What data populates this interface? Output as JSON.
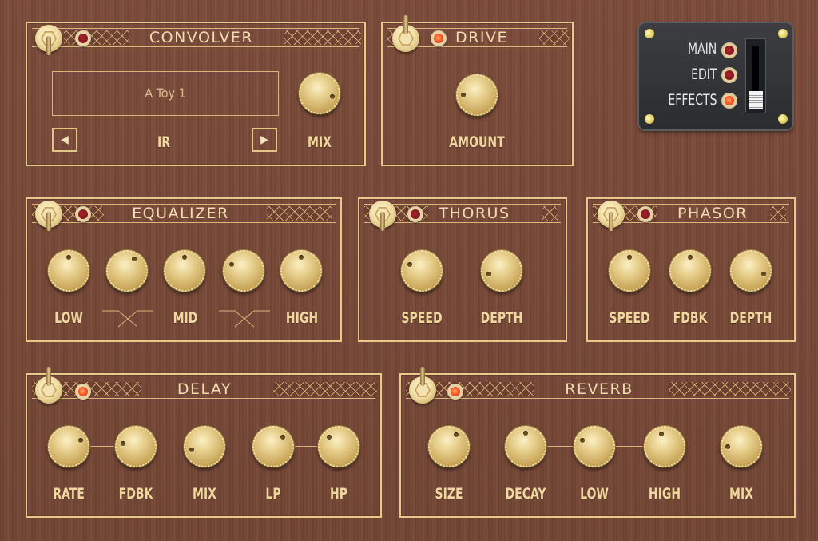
{
  "navigation": {
    "items": [
      {
        "label": "MAIN",
        "active": false
      },
      {
        "label": "EDIT",
        "active": false
      },
      {
        "label": "EFFECTS",
        "active": true
      }
    ],
    "slider_position": "EFFECTS"
  },
  "modules": {
    "convolver": {
      "title": "CONVOLVER",
      "enabled": false,
      "ir_display": "A Toy 1",
      "ir_label": "IR",
      "prev_icon": "◀",
      "next_icon": "▶",
      "knobs": [
        {
          "label": "MIX",
          "value": 0.85
        }
      ]
    },
    "drive": {
      "title": "DRIVE",
      "enabled": true,
      "knobs": [
        {
          "label": "AMOUNT",
          "value": 0.2
        }
      ]
    },
    "equalizer": {
      "title": "EQUALIZER",
      "enabled": false,
      "knobs": [
        {
          "label": "LOW",
          "value": 0.5
        },
        {
          "label": "",
          "value": 0.6
        },
        {
          "label": "MID",
          "value": 0.5
        },
        {
          "label": "",
          "value": 0.3
        },
        {
          "label": "HIGH",
          "value": 0.5
        }
      ]
    },
    "thorus": {
      "title": "THORUS",
      "enabled": false,
      "knobs": [
        {
          "label": "SPEED",
          "value": 0.3
        },
        {
          "label": "DEPTH",
          "value": 0.15
        }
      ]
    },
    "phasor": {
      "title": "PHASOR",
      "enabled": false,
      "knobs": [
        {
          "label": "SPEED",
          "value": 0.5
        },
        {
          "label": "FDBK",
          "value": 0.5
        },
        {
          "label": "DEPTH",
          "value": 0.85
        }
      ]
    },
    "delay": {
      "title": "DELAY",
      "enabled": true,
      "knobs": [
        {
          "label": "RATE",
          "value": 0.7
        },
        {
          "label": "FDBK",
          "value": 0.25
        },
        {
          "label": "MIX",
          "value": 0.15
        },
        {
          "label": "LP",
          "value": 0.65
        },
        {
          "label": "HP",
          "value": 0.35
        }
      ]
    },
    "reverb": {
      "title": "REVERB",
      "enabled": true,
      "knobs": [
        {
          "label": "SIZE",
          "value": 0.6
        },
        {
          "label": "DECAY",
          "value": 0.5
        },
        {
          "label": "LOW",
          "value": 0.3
        },
        {
          "label": "HIGH",
          "value": 0.45
        },
        {
          "label": "MIX",
          "value": 0.2
        }
      ]
    }
  }
}
